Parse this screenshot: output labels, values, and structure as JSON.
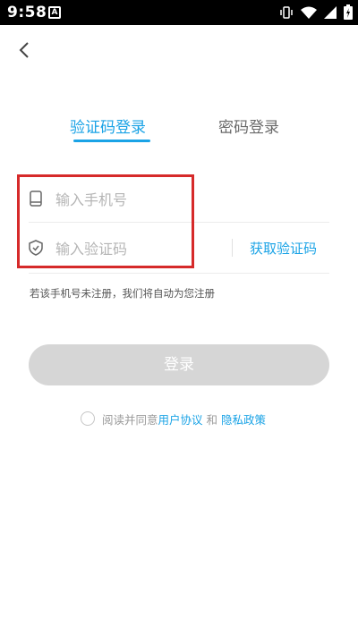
{
  "status_bar": {
    "time": "9:58",
    "notification_letter": "A",
    "icons": [
      "vibrate-icon",
      "wifi-icon",
      "signal-icon",
      "battery-icon"
    ]
  },
  "nav": {
    "back_icon": "chevron-left-icon"
  },
  "tabs": [
    {
      "label": "验证码登录",
      "active": true
    },
    {
      "label": "密码登录",
      "active": false
    }
  ],
  "form": {
    "phone_placeholder": "输入手机号",
    "code_placeholder": "输入验证码",
    "get_code_label": "获取验证码",
    "hint": "若该手机号未注册，我们将自动为您注册"
  },
  "login_button": "登录",
  "agreement": {
    "prefix": "阅读并同意",
    "user_agreement": "用户协议",
    "and": "和",
    "privacy_policy": "隐私政策"
  },
  "colors": {
    "accent": "#1aa3e6",
    "button_disabled": "#d6d6d6",
    "highlight_box": "#d62a2a"
  }
}
